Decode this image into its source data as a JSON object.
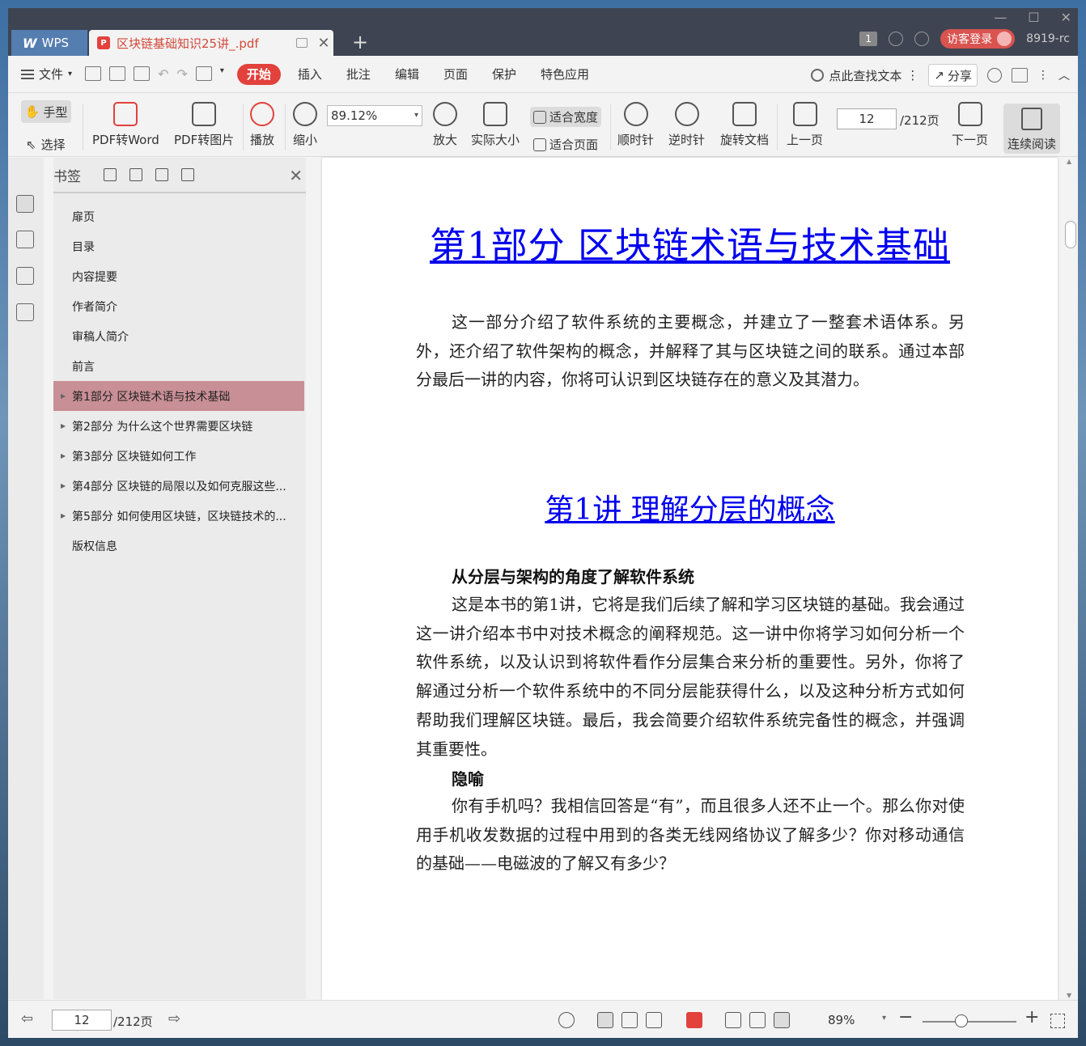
{
  "titlebar": {
    "app_name": "WPS",
    "doc_tab_title": "区块链基础知识25讲_.pdf",
    "tab_count": "1",
    "guest_login": "访客登录",
    "user_id": "8919-rc"
  },
  "menubar": {
    "file": "文件",
    "tabs": [
      "开始",
      "插入",
      "批注",
      "编辑",
      "页面",
      "保护",
      "特色应用"
    ],
    "search_placeholder": "点此查找文本",
    "share": "分享"
  },
  "toolbar": {
    "hand": "手型",
    "select": "选择",
    "pdf_to_word": "PDF转Word",
    "pdf_to_image": "PDF转图片",
    "play": "播放",
    "zoom_out": "缩小",
    "zoom_value": "89.12%",
    "zoom_in": "放大",
    "actual_size": "实际大小",
    "fit_width": "适合宽度",
    "fit_page": "适合页面",
    "clockwise": "顺时针",
    "counterclockwise": "逆时针",
    "rotate_doc": "旋转文档",
    "prev_page": "上一页",
    "page_number": "12",
    "page_total": "/212页",
    "next_page": "下一页",
    "continuous_read": "连续阅读"
  },
  "bookmarks": {
    "title": "书签",
    "items": [
      {
        "label": "扉页",
        "expandable": false
      },
      {
        "label": "目录",
        "expandable": false
      },
      {
        "label": "内容提要",
        "expandable": false
      },
      {
        "label": "作者简介",
        "expandable": false
      },
      {
        "label": "审稿人简介",
        "expandable": false
      },
      {
        "label": "前言",
        "expandable": false
      },
      {
        "label": "第1部分 区块链术语与技术基础",
        "expandable": true
      },
      {
        "label": "第2部分 为什么这个世界需要区块链",
        "expandable": true
      },
      {
        "label": "第3部分 区块链如何工作",
        "expandable": true
      },
      {
        "label": "第4部分 区块链的局限以及如何克服这些...",
        "expandable": true
      },
      {
        "label": "第5部分 如何使用区块链，区块链技术的...",
        "expandable": true
      },
      {
        "label": "版权信息",
        "expandable": false
      }
    ],
    "selected_index": 6
  },
  "document": {
    "part_title": "第1部分  区块链术语与技术基础",
    "intro": "这一部分介绍了软件系统的主要概念，并建立了一整套术语体系。另外，还介绍了软件架构的概念，并解释了其与区块链之间的联系。通过本部分最后一讲的内容，你将可认识到区块链存在的意义及其潜力。",
    "lecture_title": "第1讲  理解分层的概念",
    "section1_heading": "从分层与架构的角度了解软件系统",
    "section1_body": "这是本书的第1讲，它将是我们后续了解和学习区块链的基础。我会通过这一讲介绍本书中对技术概念的阐释规范。这一讲中你将学习如何分析一个软件系统，以及认识到将软件看作分层集合来分析的重要性。另外，你将了解通过分析一个软件系统中的不同分层能获得什么，以及这种分析方式如何帮助我们理解区块链。最后，我会简要介绍软件系统完备性的概念，并强调其重要性。",
    "section2_heading": "隐喻",
    "section2_body": "你有手机吗？我相信回答是“有”，而且很多人还不止一个。那么你对使用手机收发数据的过程中用到的各类无线网络协议了解多少？你对移动通信的基础——电磁波的了解又有多少？"
  },
  "statusbar": {
    "page_number": "12",
    "page_total": "/212页",
    "zoom": "89%"
  },
  "colors": {
    "accent": "#e2413c",
    "link": "#0000ee",
    "selected_bookmark": "#c98f96"
  }
}
